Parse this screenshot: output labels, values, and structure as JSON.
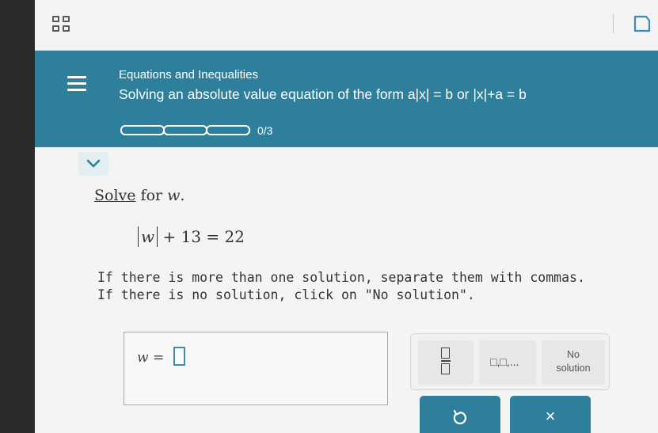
{
  "header": {
    "category": "Equations and Inequalities",
    "topic": "Solving an absolute value equation of the form a|x| = b or |x|+a = b",
    "progress": {
      "completed": 0,
      "total": 3,
      "text": "0/3"
    }
  },
  "problem": {
    "prompt_keyword": "Solve",
    "prompt_rest": " for ",
    "variable": "w",
    "prompt_end": ".",
    "equation_abs_var": "w",
    "equation_rest": "+ 13 = 22",
    "instruction_line1": "If there is more than one solution, separate them with commas.",
    "instruction_line2": "If there is no solution, click on \"No solution\"."
  },
  "answer": {
    "label_var": "w",
    "label_eq": " =",
    "value": ""
  },
  "keypad": {
    "list_label": "□,□,...",
    "no_solution_line1": "No",
    "no_solution_line2": "solution"
  },
  "buttons": {
    "clear_label": "×"
  },
  "icons": {
    "apps": "grid-icon",
    "menu": "hamburger-menu-icon",
    "collapse": "chevron-down-icon",
    "book": "book-icon",
    "undo": "undo-icon"
  },
  "colors": {
    "header_bg": "#2d7f9b",
    "button_bg": "#2d7f9b",
    "input_border": "#3a8bb5"
  }
}
